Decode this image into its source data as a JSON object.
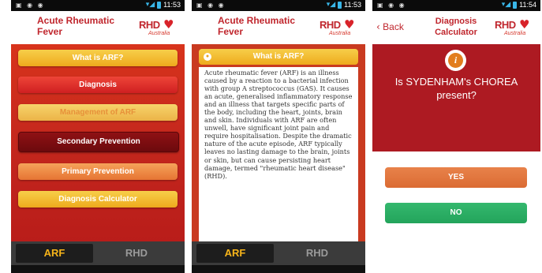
{
  "status_bar": {
    "screen1_time": "11:53",
    "screen2_time": "11:53",
    "screen3_time": "11:54",
    "notification_icons": "▣ ◉ ◉",
    "signal_icon": "signal-wifi-icon"
  },
  "app": {
    "title": "Acute Rheumatic Fever",
    "logo_text": "RHD",
    "logo_subtext": "Australia",
    "logo_icon": "heart-icon"
  },
  "colors": {
    "brand_red": "#c0262d",
    "menu_yellow": "#eeaa1d",
    "tab_active": "#f6b41a",
    "yes_orange": "#db6b33",
    "no_green": "#23a45b"
  },
  "screen1": {
    "menu": [
      "What is ARF?",
      "Diagnosis",
      "Management of ARF",
      "Secondary Prevention",
      "Primary Prevention",
      "Diagnosis Calculator"
    ]
  },
  "tabs": {
    "arf": "ARF",
    "rhd": "RHD"
  },
  "screen2": {
    "section_title": "What is ARF?",
    "collapse_icon": "minus-circle-icon",
    "body_text": "Acute rheumatic fever (ARF) is an illness caused by a reaction to a bacterial infection with group A streptococcus (GAS). It causes an acute, generalised inflammatory response and an illness that targets specific parts of the body, including the heart, joints, brain and skin. Individuals with ARF are often unwell, have significant joint pain and require hospitalisation. Despite the dramatic nature of the acute episode, ARF typically leaves no lasting damage to the brain, joints or skin, but can cause persisting heart damage, termed \"rheumatic heart disease\" (RHD)."
  },
  "screen3": {
    "back_label": "Back",
    "title": "Diagnosis Calculator",
    "info_icon": "info-icon",
    "question": "Is SYDENHAM's CHOREA present?",
    "yes_label": "YES",
    "no_label": "NO"
  }
}
